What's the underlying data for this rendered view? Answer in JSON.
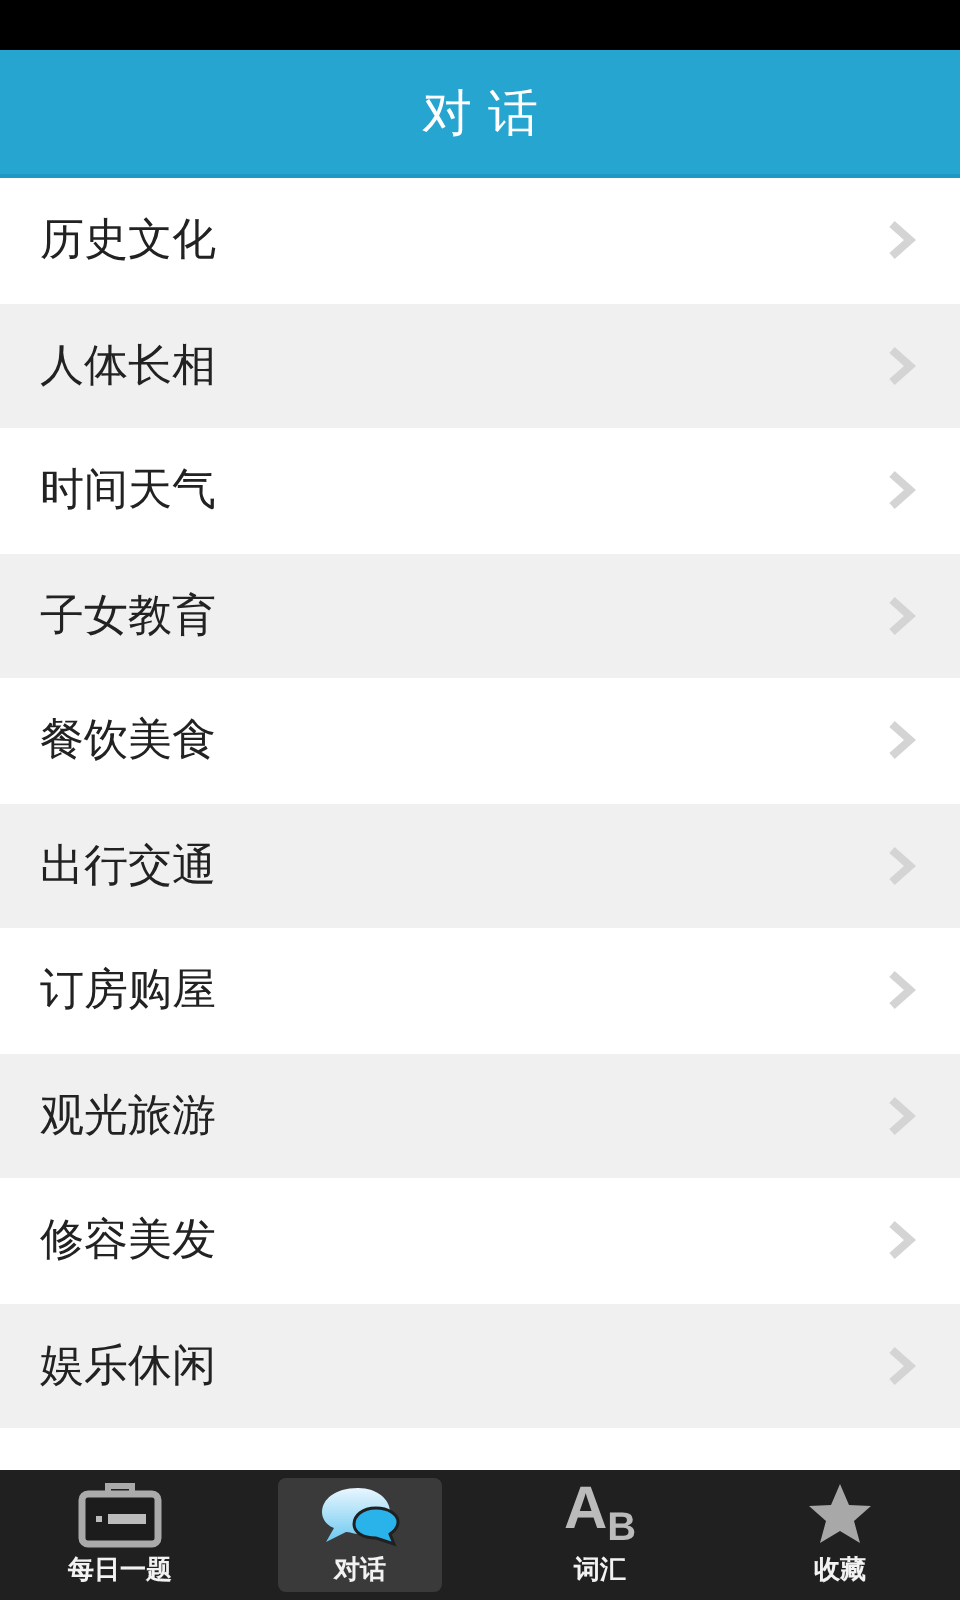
{
  "header": {
    "title": "对 话"
  },
  "items": [
    {
      "label": "历史文化"
    },
    {
      "label": "人体长相"
    },
    {
      "label": "时间天气"
    },
    {
      "label": "子女教育"
    },
    {
      "label": "餐饮美食"
    },
    {
      "label": "出行交通"
    },
    {
      "label": "订房购屋"
    },
    {
      "label": "观光旅游"
    },
    {
      "label": "修容美发"
    },
    {
      "label": "娱乐休闲"
    }
  ],
  "tab_bar": [
    {
      "label": "每日一题",
      "kind": "card",
      "selected": false
    },
    {
      "label": "对话",
      "kind": "chat",
      "selected": true
    },
    {
      "label": "词汇",
      "kind": "letters",
      "glyphs": [
        "A",
        "B"
      ],
      "selected": false
    },
    {
      "label": "收藏",
      "kind": "star",
      "selected": false
    }
  ]
}
